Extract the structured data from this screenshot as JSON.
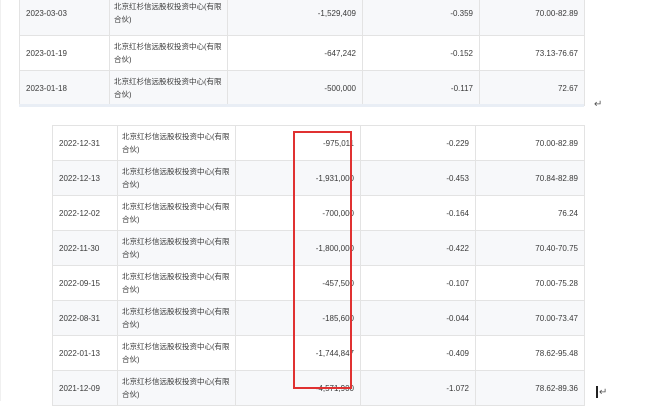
{
  "top_rows": [
    {
      "date": "2023-03-03",
      "name": "北京红杉信远股权投资中心(有限合伙)",
      "amount": "-1,529,409",
      "ratio": "-0.359",
      "price": "70.00-82.89"
    },
    {
      "date": "2023-01-19",
      "name": "北京红杉信远股权投资中心(有限合伙)",
      "amount": "-647,242",
      "ratio": "-0.152",
      "price": "73.13-76.67"
    },
    {
      "date": "2023-01-18",
      "name": "北京红杉信远股权投资中心(有限合伙)",
      "amount": "-500,000",
      "ratio": "-0.117",
      "price": "72.67"
    }
  ],
  "bottom_rows": [
    {
      "date": "2022-12-31",
      "name": "北京红杉信远股权投资中心(有限合伙)",
      "amount": "-975,011",
      "ratio": "-0.229",
      "price": "70.00-82.89"
    },
    {
      "date": "2022-12-13",
      "name": "北京红杉信远股权投资中心(有限合伙)",
      "amount": "-1,931,000",
      "ratio": "-0.453",
      "price": "70.84-82.89"
    },
    {
      "date": "2022-12-02",
      "name": "北京红杉信远股权投资中心(有限合伙)",
      "amount": "-700,000",
      "ratio": "-0.164",
      "price": "76.24"
    },
    {
      "date": "2022-11-30",
      "name": "北京红杉信远股权投资中心(有限合伙)",
      "amount": "-1,800,000",
      "ratio": "-0.422",
      "price": "70.40-70.75"
    },
    {
      "date": "2022-09-15",
      "name": "北京红杉信远股权投资中心(有限合伙)",
      "amount": "-457,500",
      "ratio": "-0.107",
      "price": "70.00-75.28"
    },
    {
      "date": "2022-08-31",
      "name": "北京红杉信远股权投资中心(有限合伙)",
      "amount": "-185,600",
      "ratio": "-0.044",
      "price": "70.00-73.47"
    },
    {
      "date": "2022-01-13",
      "name": "北京红杉信远股权投资中心(有限合伙)",
      "amount": "-1,744,847",
      "ratio": "-0.409",
      "price": "78.62-95.48"
    },
    {
      "date": "2021-12-09",
      "name": "北京红杉信远股权投资中心(有限合伙)",
      "amount": "-4,571,900",
      "ratio": "-1.072",
      "price": "78.62-89.36"
    }
  ],
  "marks": {
    "paragraph_mark": "↵"
  },
  "colors": {
    "highlight_border": "#e03131"
  }
}
